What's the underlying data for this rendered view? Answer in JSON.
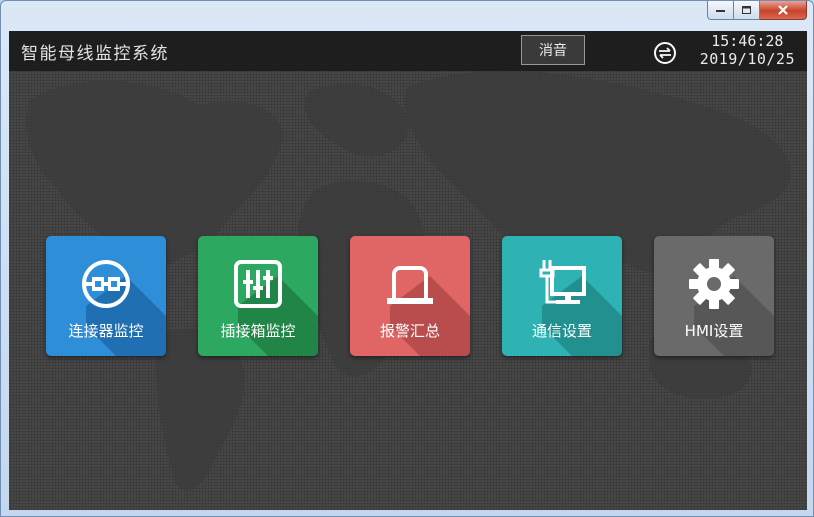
{
  "window": {
    "controls": [
      {
        "name": "minimize-icon"
      },
      {
        "name": "maximize-icon"
      },
      {
        "name": "close-icon"
      }
    ]
  },
  "header": {
    "title": "智能母线监控系统",
    "mute_label": "消音",
    "link_icon": "connection-status-icon",
    "time": "15:46:28",
    "date": "2019/10/25"
  },
  "tiles": [
    {
      "label": "连接器监控",
      "icon": "connector-plug-icon",
      "color": "#2f8ed8",
      "shade": "#1f6fb2"
    },
    {
      "label": "插接箱监控",
      "icon": "plug-box-icon",
      "color": "#2da860",
      "shade": "#218548"
    },
    {
      "label": "报警汇总",
      "icon": "alarm-lamp-icon",
      "color": "#e06565",
      "shade": "#b94c4c"
    },
    {
      "label": "通信设置",
      "icon": "network-monitor-icon",
      "color": "#2fb2b4",
      "shade": "#22908f"
    },
    {
      "label": "HMI设置",
      "icon": "gear-icon",
      "color": "#6a6a6a",
      "shade": "#575757"
    }
  ]
}
